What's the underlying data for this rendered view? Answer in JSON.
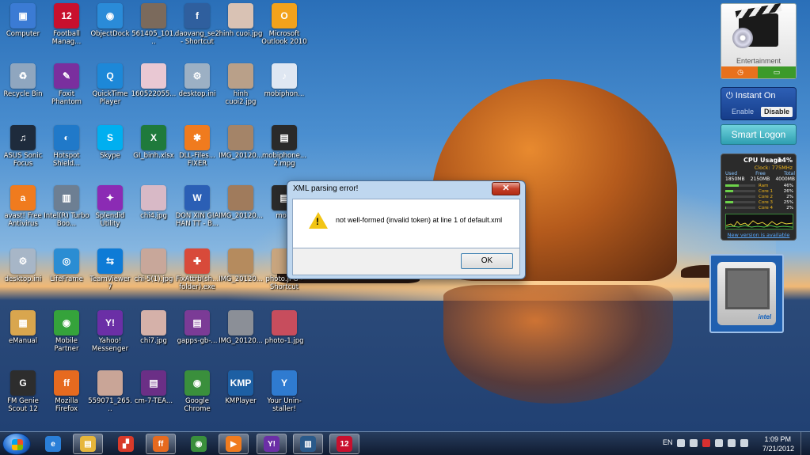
{
  "desktop_icons": [
    {
      "label": "Computer",
      "color": "#3b7bd4",
      "glyph": "▣"
    },
    {
      "label": "Football Manag...",
      "color": "#c8102e",
      "glyph": "12"
    },
    {
      "label": "ObjectDock",
      "color": "#2a8bd8",
      "glyph": "◉"
    },
    {
      "label": "561405_101...",
      "color": "#7b6a5c",
      "glyph": ""
    },
    {
      "label": "daovang_se2 - Shortcut",
      "color": "#2f5f9e",
      "glyph": "f"
    },
    {
      "label": "hinh cuoi.jpg",
      "color": "#d9c2b4",
      "glyph": ""
    },
    {
      "label": "Microsoft Outlook 2010",
      "color": "#f3a21b",
      "glyph": "O"
    },
    {
      "label": "Recycle Bin",
      "color": "#8fa6bf",
      "glyph": "♻"
    },
    {
      "label": "Foxit Phantom",
      "color": "#7a2f9e",
      "glyph": "✎"
    },
    {
      "label": "QuickTime Player",
      "color": "#1d88d8",
      "glyph": "Q"
    },
    {
      "label": "160522055...",
      "color": "#e9c8d3",
      "glyph": ""
    },
    {
      "label": "desktop.ini",
      "color": "#9cb0c4",
      "glyph": "⚙"
    },
    {
      "label": "hinh cuoi2.jpg",
      "color": "#b9a089",
      "glyph": ""
    },
    {
      "label": "mobiphon...",
      "color": "#dfe7f2",
      "glyph": "♪"
    },
    {
      "label": "ASUS Sonic Focus",
      "color": "#1e2b3c",
      "glyph": "♫"
    },
    {
      "label": "Hotspot Shield...",
      "color": "#2079c9",
      "glyph": "◐"
    },
    {
      "label": "Skype",
      "color": "#00aff0",
      "glyph": "S"
    },
    {
      "label": "GI_binh.xlsx",
      "color": "#1f7a3c",
      "glyph": "X"
    },
    {
      "label": "DLL-Files... FIXER",
      "color": "#f07b1e",
      "glyph": "✱"
    },
    {
      "label": "IMG_20120...",
      "color": "#a48468",
      "glyph": ""
    },
    {
      "label": "mobiphone... 2.mpg",
      "color": "#2a2a2a",
      "glyph": "▤"
    },
    {
      "label": "avast! Free Antivirus",
      "color": "#f07b1e",
      "glyph": "a"
    },
    {
      "label": "Intel(R) Turbo Boo...",
      "color": "#6d7f93",
      "glyph": "▥"
    },
    {
      "label": "Splendid Utility",
      "color": "#8b2bb4",
      "glyph": "✦"
    },
    {
      "label": "chi4.jpg",
      "color": "#d8b9c6",
      "glyph": ""
    },
    {
      "label": "DON XIN GIA HAN TT - B...",
      "color": "#2b5fb5",
      "glyph": "W"
    },
    {
      "label": "IMG_20120...",
      "color": "#a07b5c",
      "glyph": ""
    },
    {
      "label": "mobi",
      "color": "#2a2a2a",
      "glyph": "▤"
    },
    {
      "label": "desktop.ini",
      "color": "#a7b6c7",
      "glyph": "⚙"
    },
    {
      "label": "LifeFrame",
      "color": "#2b8dd3",
      "glyph": "◎"
    },
    {
      "label": "TeamViewer 7",
      "color": "#0e7bd6",
      "glyph": "⇆"
    },
    {
      "label": "chi-5(1).jpg",
      "color": "#c8a79a",
      "glyph": ""
    },
    {
      "label": "FixAttrb(sh... folder).exe",
      "color": "#d84a3a",
      "glyph": "✚"
    },
    {
      "label": "IMG_20120...",
      "color": "#b58b5e",
      "glyph": ""
    },
    {
      "label": "photo.JPG - Shortcut",
      "color": "#c8a57e",
      "glyph": ""
    },
    {
      "label": "eManual",
      "color": "#d9a64e",
      "glyph": "▦"
    },
    {
      "label": "Mobile Partner",
      "color": "#35a33b",
      "glyph": "◉"
    },
    {
      "label": "Yahoo! Messenger",
      "color": "#6b2fa6",
      "glyph": "Y!"
    },
    {
      "label": "chi7.jpg",
      "color": "#d5b1a9",
      "glyph": ""
    },
    {
      "label": "gapps-gb-...",
      "color": "#7b3b96",
      "glyph": "▤"
    },
    {
      "label": "IMG_20120...",
      "color": "#8b8f97",
      "glyph": ""
    },
    {
      "label": "photo-1.jpg",
      "color": "#c74d5d",
      "glyph": ""
    },
    {
      "label": "FM Genie Scout 12",
      "color": "#2d2d2d",
      "glyph": "G"
    },
    {
      "label": "Mozilla Firefox",
      "color": "#e66a1f",
      "glyph": "ff"
    },
    {
      "label": "559071_265...",
      "color": "#c9a597",
      "glyph": ""
    },
    {
      "label": "cm-7-TEA...",
      "color": "#6b2f86",
      "glyph": "▤"
    },
    {
      "label": "Google Chrome",
      "color": "#3a8f3c",
      "glyph": "◉"
    },
    {
      "label": "KMPlayer",
      "color": "#1d5fa3",
      "glyph": "KMP"
    },
    {
      "label": "Your Unin-staller!",
      "color": "#2f7bd0",
      "glyph": "Y"
    }
  ],
  "gadgets": {
    "entertainment": {
      "title": "Entertainment",
      "left_button": "◷",
      "right_button": "▭"
    },
    "instant_on": {
      "title": "⏻ Instant On",
      "enable": "Enable",
      "disable": "Disable"
    },
    "smart_logon": {
      "title": "Smart Logon"
    },
    "cpu": {
      "title": "CPU Usage",
      "percent": "14%",
      "clock": "Clock: 775MHz",
      "mem_headers": [
        "Used",
        "Free",
        "Total"
      ],
      "mem_values": [
        "1850MB",
        "2150MB",
        "4000MB"
      ],
      "rows": [
        {
          "name": "Ram",
          "value": "46%",
          "level": 0.46
        },
        {
          "name": "Core 1",
          "value": "26%",
          "level": 0.26
        },
        {
          "name": "Core 2",
          "value": "2%",
          "level": 0.02
        },
        {
          "name": "Core 3",
          "value": "25%",
          "level": 0.25
        },
        {
          "name": "Core 4",
          "value": "2%",
          "level": 0.02
        }
      ],
      "new_version": "New version is available"
    },
    "intel": {
      "logo": "intel"
    }
  },
  "dialog": {
    "title": "XML parsing error!",
    "close": "✕",
    "message": "not well-formed (invalid token) at line 1 of default.xml",
    "ok": "OK"
  },
  "taskbar": {
    "pinned": [
      {
        "name": "ie",
        "glyph": "e",
        "color": "#2a7fd8",
        "active": false
      },
      {
        "name": "explorer",
        "glyph": "▤",
        "color": "#e6b63b",
        "active": true
      },
      {
        "name": "gadgets",
        "glyph": "▞",
        "color": "#d83a2a",
        "active": false
      },
      {
        "name": "firefox",
        "glyph": "ff",
        "color": "#e66a1f",
        "active": true
      },
      {
        "name": "chrome",
        "glyph": "◉",
        "color": "#3a8f3c",
        "active": false
      },
      {
        "name": "media-player",
        "glyph": "▶",
        "color": "#f07b1e",
        "active": true
      },
      {
        "name": "yahoo-messenger",
        "glyph": "Y!",
        "color": "#6b2fa6",
        "active": true
      },
      {
        "name": "intel-turbo",
        "glyph": "▥",
        "color": "#2a5a8a",
        "active": true
      },
      {
        "name": "football-manager",
        "glyph": "12",
        "color": "#c8102e",
        "active": true
      }
    ],
    "tray": {
      "lang": "EN",
      "time": "1:09 PM",
      "date": "7/21/2012"
    }
  }
}
